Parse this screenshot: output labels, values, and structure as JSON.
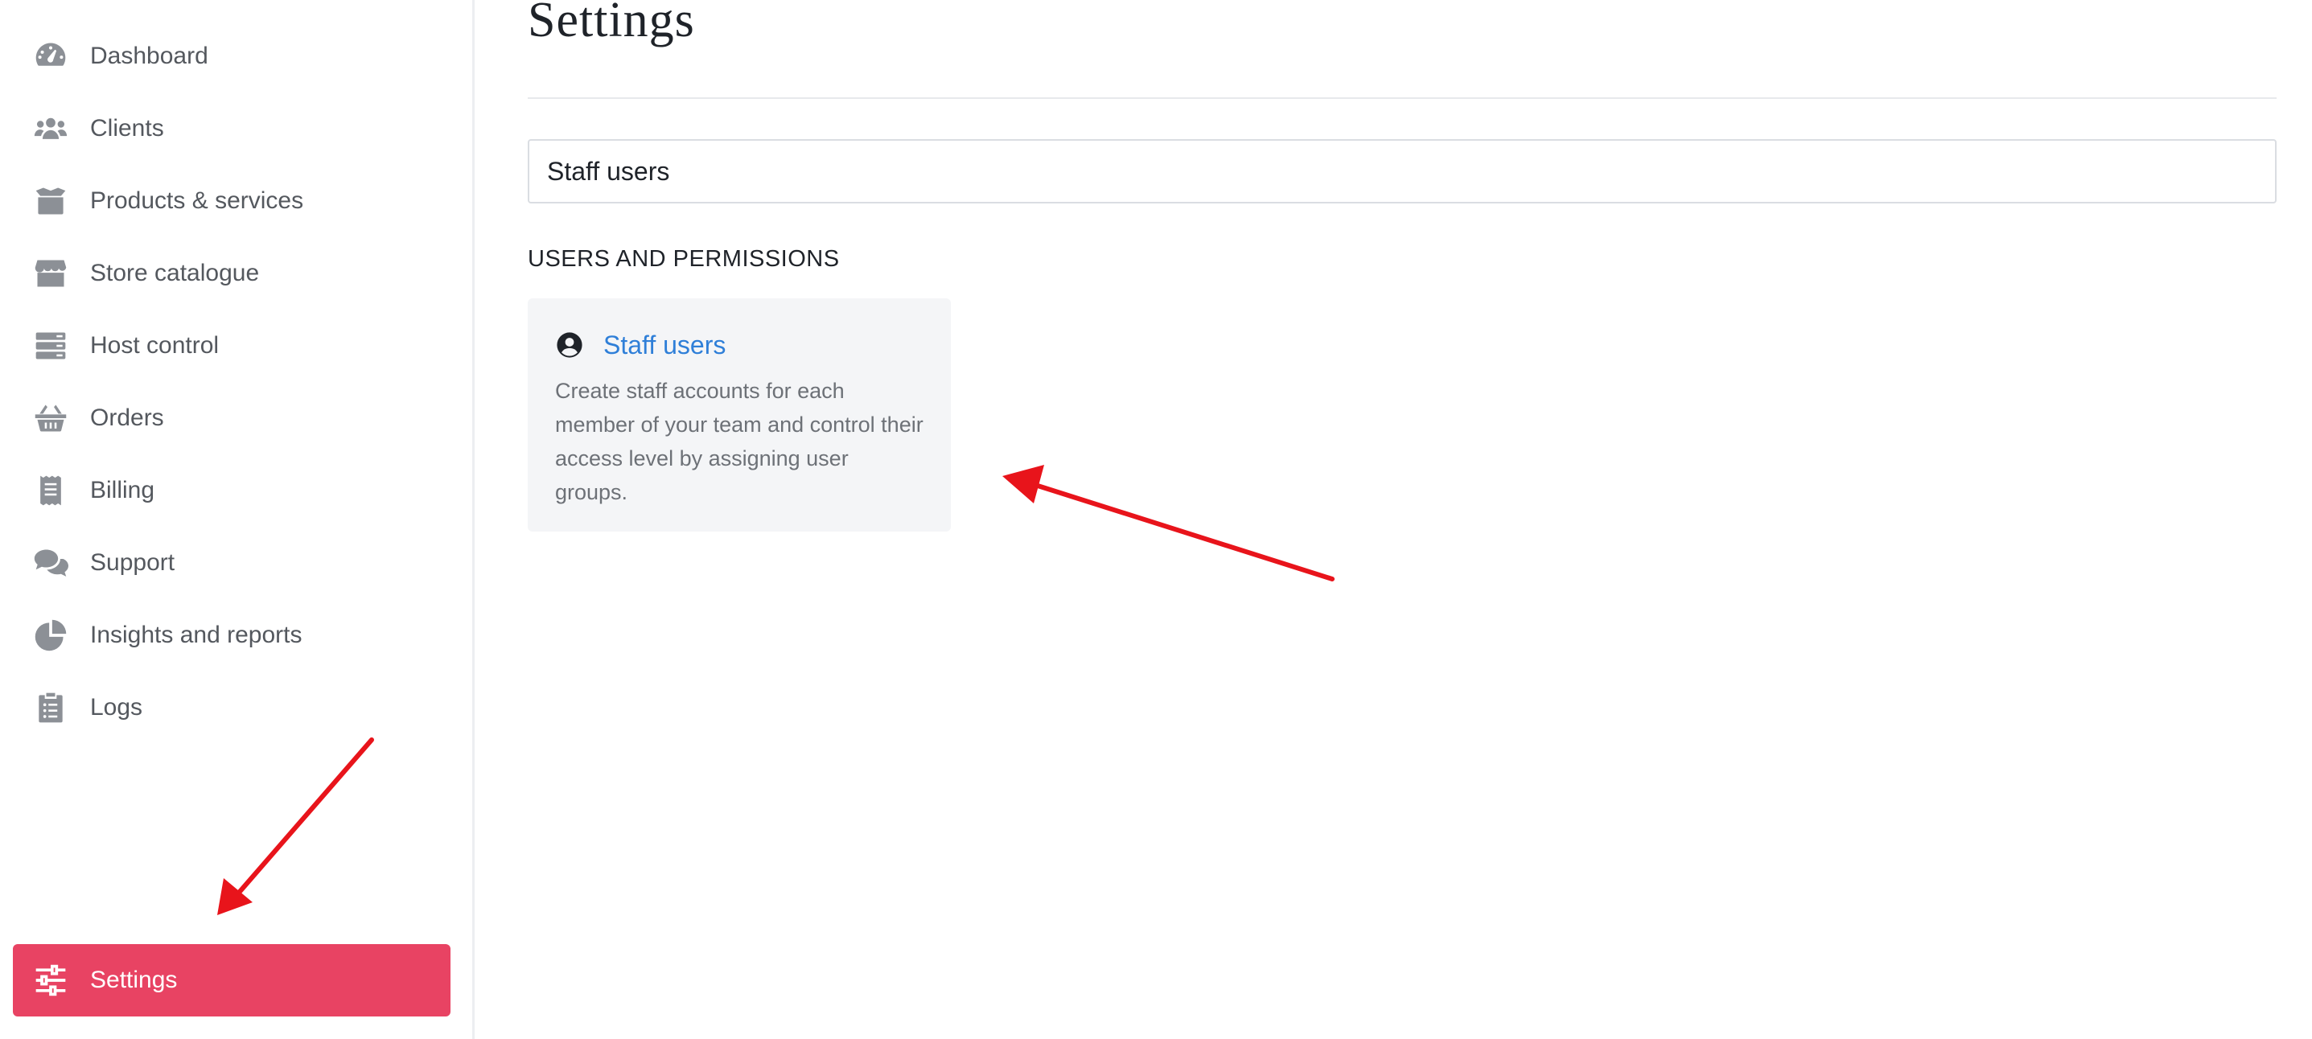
{
  "sidebar": {
    "items": [
      {
        "label": "Dashboard",
        "icon": "dashboard-gauge-icon"
      },
      {
        "label": "Clients",
        "icon": "users-icon"
      },
      {
        "label": "Products & services",
        "icon": "box-icon"
      },
      {
        "label": "Store catalogue",
        "icon": "store-icon"
      },
      {
        "label": "Host control",
        "icon": "server-icon"
      },
      {
        "label": "Orders",
        "icon": "basket-icon"
      },
      {
        "label": "Billing",
        "icon": "receipt-icon"
      },
      {
        "label": "Support",
        "icon": "comments-icon"
      },
      {
        "label": "Insights and reports",
        "icon": "pie-chart-icon"
      },
      {
        "label": "Logs",
        "icon": "clipboard-list-icon"
      }
    ],
    "settings": {
      "label": "Settings",
      "icon": "sliders-icon"
    }
  },
  "main": {
    "title": "Settings",
    "search": {
      "value": "Staff users"
    },
    "section": {
      "heading": "USERS AND PERMISSIONS",
      "card": {
        "icon": "user-circle-icon",
        "title": "Staff users",
        "description": "Create staff accounts for each member of your team and control their access level by assigning user groups."
      }
    }
  },
  "colors": {
    "accent": "#e84363",
    "link": "#2f7fd8",
    "annotation_arrow": "#e8141b",
    "nav_icon": "#8c9096",
    "card_bg": "#f4f5f7"
  }
}
